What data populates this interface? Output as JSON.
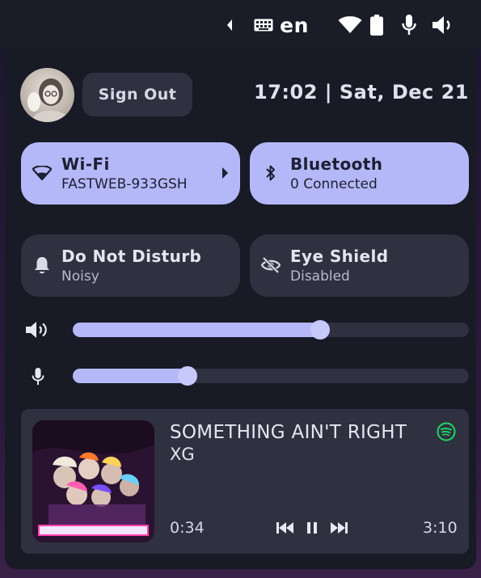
{
  "topbar": {
    "language": "en",
    "icons": [
      "chevron-left-icon",
      "keyboard-icon",
      "wifi-icon",
      "battery-icon",
      "microphone-icon",
      "volume-icon"
    ]
  },
  "header": {
    "sign_out_label": "Sign Out",
    "clock": "17:02 | Sat, Dec 21"
  },
  "tiles": {
    "wifi": {
      "title": "Wi-Fi",
      "subtitle": "FASTWEB-933GSH",
      "active": true
    },
    "bluetooth": {
      "title": "Bluetooth",
      "subtitle": "0 Connected",
      "active": true
    },
    "dnd": {
      "title": "Do Not Disturb",
      "subtitle": "Noisy",
      "active": false
    },
    "eye_shield": {
      "title": "Eye Shield",
      "subtitle": "Disabled",
      "active": false
    }
  },
  "sliders": {
    "volume": {
      "level": 0.625
    },
    "microphone": {
      "level": 0.29
    }
  },
  "media": {
    "title": "SOMETHING AIN'T RIGHT",
    "artist": "XG",
    "elapsed": "0:34",
    "duration": "3:10",
    "source_icon": "spotify-icon",
    "playing": true
  },
  "colors": {
    "accent": "#b5b8f8",
    "panel": "#181a26",
    "tile_off": "#2f3140"
  }
}
